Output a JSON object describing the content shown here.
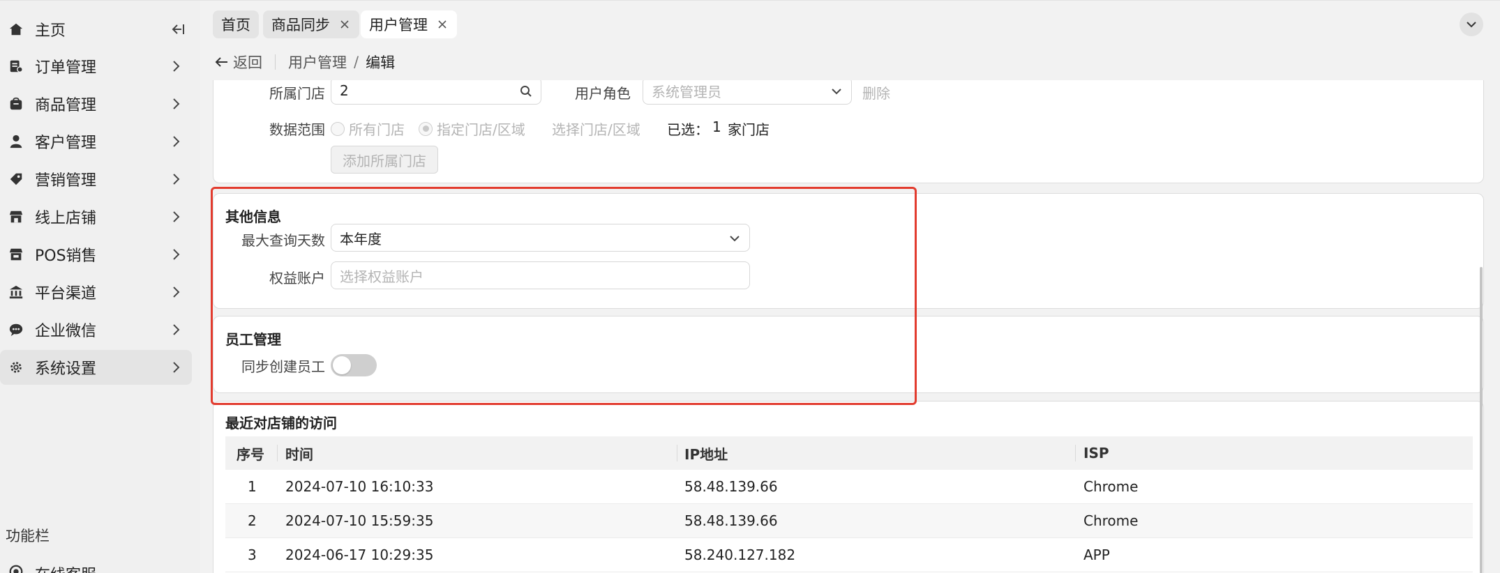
{
  "sidebar": {
    "home_label": "主页",
    "items": [
      {
        "label": "订单管理",
        "icon": "order-icon"
      },
      {
        "label": "商品管理",
        "icon": "product-icon"
      },
      {
        "label": "客户管理",
        "icon": "user-icon"
      },
      {
        "label": "营销管理",
        "icon": "tag-icon"
      },
      {
        "label": "线上店铺",
        "icon": "store-icon"
      },
      {
        "label": "POS销售",
        "icon": "pos-icon"
      },
      {
        "label": "平台渠道",
        "icon": "bank-icon"
      },
      {
        "label": "企业微信",
        "icon": "chat-icon"
      },
      {
        "label": "系统设置",
        "icon": "gear-icon"
      }
    ],
    "section_label": "功能栏",
    "bottom_item_label": "在线客服"
  },
  "tabs": [
    {
      "label": "首页",
      "closable": false
    },
    {
      "label": "商品同步",
      "closable": true
    },
    {
      "label": "用户管理",
      "closable": true
    }
  ],
  "breadcrumb": {
    "back_label": "返回",
    "path": [
      "用户管理",
      "编辑"
    ],
    "separator": "/"
  },
  "store_section": {
    "store_label": "所属门店",
    "store_value": "2",
    "role_label": "用户角色",
    "role_value": "系统管理员",
    "delete_label": "删除",
    "scope_label": "数据范围",
    "scope_options": [
      "所有门店",
      "指定门店/区域"
    ],
    "select_link": "选择门店/区域",
    "selected_prefix": "已选：",
    "selected_count": "1",
    "selected_suffix": "家门店",
    "add_button": "添加所属门店"
  },
  "other_info": {
    "title": "其他信息",
    "max_days_label": "最大查询天数",
    "max_days_value": "本年度",
    "benefit_label": "权益账户",
    "benefit_placeholder": "选择权益账户"
  },
  "employee": {
    "title": "员工管理",
    "sync_label": "同步创建员工",
    "sync_enabled": false
  },
  "visits": {
    "title": "最近对店铺的访问",
    "columns": [
      "序号",
      "时间",
      "IP地址",
      "ISP"
    ],
    "rows": [
      [
        "1",
        "2024-07-10 16:10:33",
        "58.48.139.66",
        "Chrome"
      ],
      [
        "2",
        "2024-07-10 15:59:35",
        "58.48.139.66",
        "Chrome"
      ],
      [
        "3",
        "2024-06-17 10:29:35",
        "58.240.127.182",
        "APP"
      ]
    ]
  },
  "colors": {
    "highlight": "#e23b2e",
    "card_bg": "#ffffff",
    "page_bg": "#f2f2f2"
  }
}
